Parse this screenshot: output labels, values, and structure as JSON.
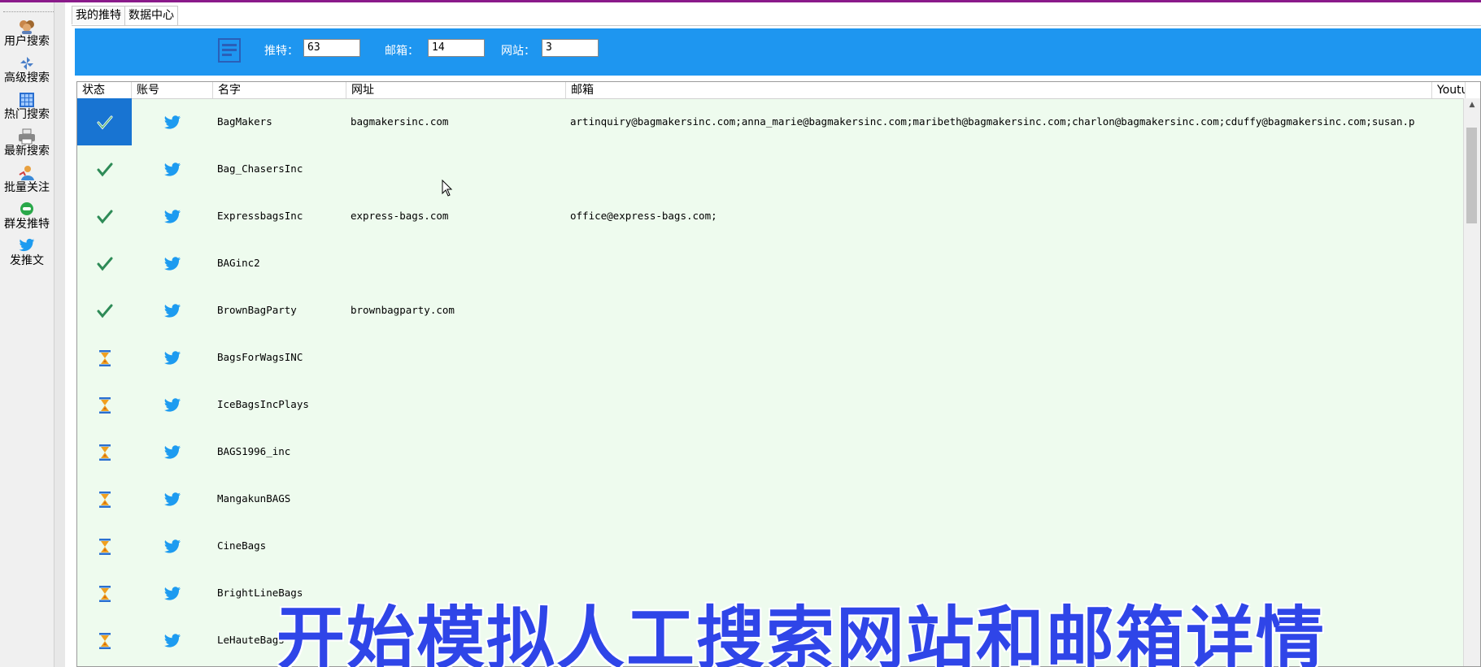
{
  "sidebar": {
    "items": [
      {
        "label": "用户搜索",
        "icon": "users-icon"
      },
      {
        "label": "高级搜索",
        "icon": "pinwheel-icon"
      },
      {
        "label": "热门搜索",
        "icon": "grid-icon"
      },
      {
        "label": "最新搜索",
        "icon": "printer-icon"
      },
      {
        "label": "批量关注",
        "icon": "person-icon"
      },
      {
        "label": "群发推特",
        "icon": "chat-bubble-icon"
      },
      {
        "label": "发推文",
        "icon": "twitter-bird-icon"
      }
    ]
  },
  "tabs": [
    {
      "label": "我的推特",
      "active": false
    },
    {
      "label": "数据中心",
      "active": true
    }
  ],
  "stats": {
    "twitter_label": "推特：",
    "twitter_value": "63",
    "email_label": "邮箱：",
    "email_value": "14",
    "website_label": "网站：",
    "website_value": "3"
  },
  "table": {
    "columns": [
      "状态",
      "账号",
      "名字",
      "网址",
      "邮箱",
      "Youtu"
    ],
    "rows": [
      {
        "status": "done",
        "name": "BagMakers",
        "url": "bagmakersinc.com",
        "email": "artinquiry@bagmakersinc.com;anna_marie@bagmakersinc.com;maribeth@bagmakersinc.com;charlon@bagmakersinc.com;cduffy@bagmakersinc.com;susan.p",
        "selected": true
      },
      {
        "status": "done",
        "name": "Bag_ChasersInc",
        "url": "",
        "email": ""
      },
      {
        "status": "done",
        "name": "ExpressbagsInc",
        "url": "express-bags.com",
        "email": "office@express-bags.com;"
      },
      {
        "status": "done",
        "name": "BAGinc2",
        "url": "",
        "email": ""
      },
      {
        "status": "done",
        "name": "BrownBagParty",
        "url": "brownbagparty.com",
        "email": ""
      },
      {
        "status": "pending",
        "name": "BagsForWagsINC",
        "url": "",
        "email": ""
      },
      {
        "status": "pending",
        "name": "IceBagsIncPlays",
        "url": "",
        "email": ""
      },
      {
        "status": "pending",
        "name": "BAGS1996_inc",
        "url": "",
        "email": ""
      },
      {
        "status": "pending",
        "name": "MangakunBAGS",
        "url": "",
        "email": ""
      },
      {
        "status": "pending",
        "name": "CineBags",
        "url": "",
        "email": ""
      },
      {
        "status": "pending",
        "name": "BrightLineBags",
        "url": "",
        "email": ""
      },
      {
        "status": "pending",
        "name": "LeHauteBags",
        "url": "",
        "email": ""
      }
    ]
  },
  "overlay": {
    "caption": "开始模拟人工搜索网站和邮箱详情"
  },
  "colors": {
    "toolbar_blue": "#1e96f0",
    "grid_background": "#eefbee",
    "twitter_blue": "#1d9bf0",
    "check_green": "#2e8b57",
    "caption_blue": "#2f45e8"
  }
}
